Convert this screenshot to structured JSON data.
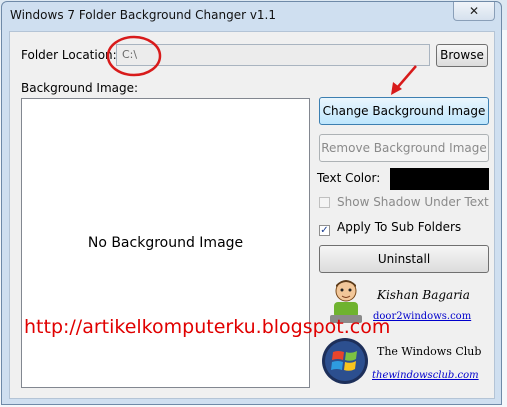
{
  "window": {
    "title": "Windows 7 Folder Background Changer v1.1",
    "close_glyph": "✕"
  },
  "folder": {
    "label": "Folder Location:",
    "value": "C:\\",
    "browse_label": "Browse"
  },
  "background": {
    "label": "Background Image:",
    "empty_text": "No Background Image"
  },
  "actions": {
    "change_label": "Change Background Image",
    "remove_label": "Remove Background Image",
    "uninstall_label": "Uninstall"
  },
  "text_color": {
    "label": "Text Color:",
    "value": "#000000"
  },
  "options": {
    "shadow": {
      "label": "Show Shadow Under Text",
      "checked": false,
      "enabled": false
    },
    "subfolders": {
      "label": "Apply To Sub Folders",
      "checked": true,
      "enabled": true
    }
  },
  "credits": {
    "author_name": "Kishan Bagaria",
    "author_link": "door2windows.com",
    "club_name": "The Windows Club",
    "club_link": "thewindowsclub.com"
  },
  "watermark": {
    "text": "http://artikelkomputerku.blogspot.com"
  },
  "annotation_colors": {
    "circle": "#d81b1b",
    "arrow": "#d81b1b",
    "watermark": "#e00000"
  }
}
